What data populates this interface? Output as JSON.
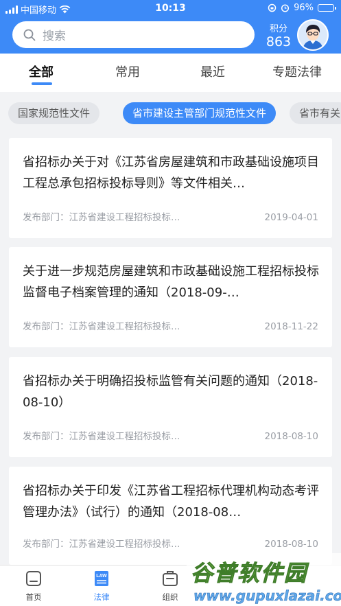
{
  "status_bar": {
    "carrier": "中国移动",
    "time": "10:13",
    "battery": "96%",
    "battery_level": 0.96
  },
  "search": {
    "placeholder": "搜索"
  },
  "points": {
    "label": "积分",
    "value": "863"
  },
  "tabs": [
    {
      "label": "全部",
      "active": true
    },
    {
      "label": "常用",
      "active": false
    },
    {
      "label": "最近",
      "active": false
    },
    {
      "label": "专题法律",
      "active": false
    }
  ],
  "chips": [
    {
      "label": "国家规范性文件",
      "active": false
    },
    {
      "label": "省市建设主管部门规范性文件",
      "active": true
    },
    {
      "label": "省市有关",
      "active": false
    }
  ],
  "documents": [
    {
      "title": "省招标办关于对《江苏省房屋建筑和市政基础设施项目工程总承包招标投标导则》等文件相关…",
      "dept": "发布部门：江苏省建设工程招标投标…",
      "date": "2019-04-01"
    },
    {
      "title": "关于进一步规范房屋建筑和市政基础设施工程招标投标监督电子档案管理的通知（2018-09-…",
      "dept": "发布部门：江苏省建设工程招标投标…",
      "date": "2018-11-22"
    },
    {
      "title": "省招标办关于明确招投标监管有关问题的通知（2018-08-10）",
      "dept": "发布部门：江苏省建设工程招标投标…",
      "date": "2018-08-10"
    },
    {
      "title": "省招标办关于印发《江苏省工程招标代理机构动态考评管理办法》（试行）的通知（2018-08…",
      "dept": "发布部门：江苏省建设工程招标投标…",
      "date": "2018-08-10"
    }
  ],
  "tabbar": [
    {
      "label": "首页",
      "icon": "home-icon",
      "active": false
    },
    {
      "label": "法律",
      "icon": "law-book-icon",
      "icon_text": "LAW",
      "active": true
    },
    {
      "label": "组织",
      "icon": "organization-icon",
      "active": false
    }
  ],
  "watermark": {
    "name": "谷普软件园",
    "url": "www.gupuxlazai.com"
  },
  "colors": {
    "primary": "#3d8af7",
    "background": "#f2f3f5",
    "chip_inactive": "#e4e6ea",
    "muted_text": "#9a9ea5"
  }
}
